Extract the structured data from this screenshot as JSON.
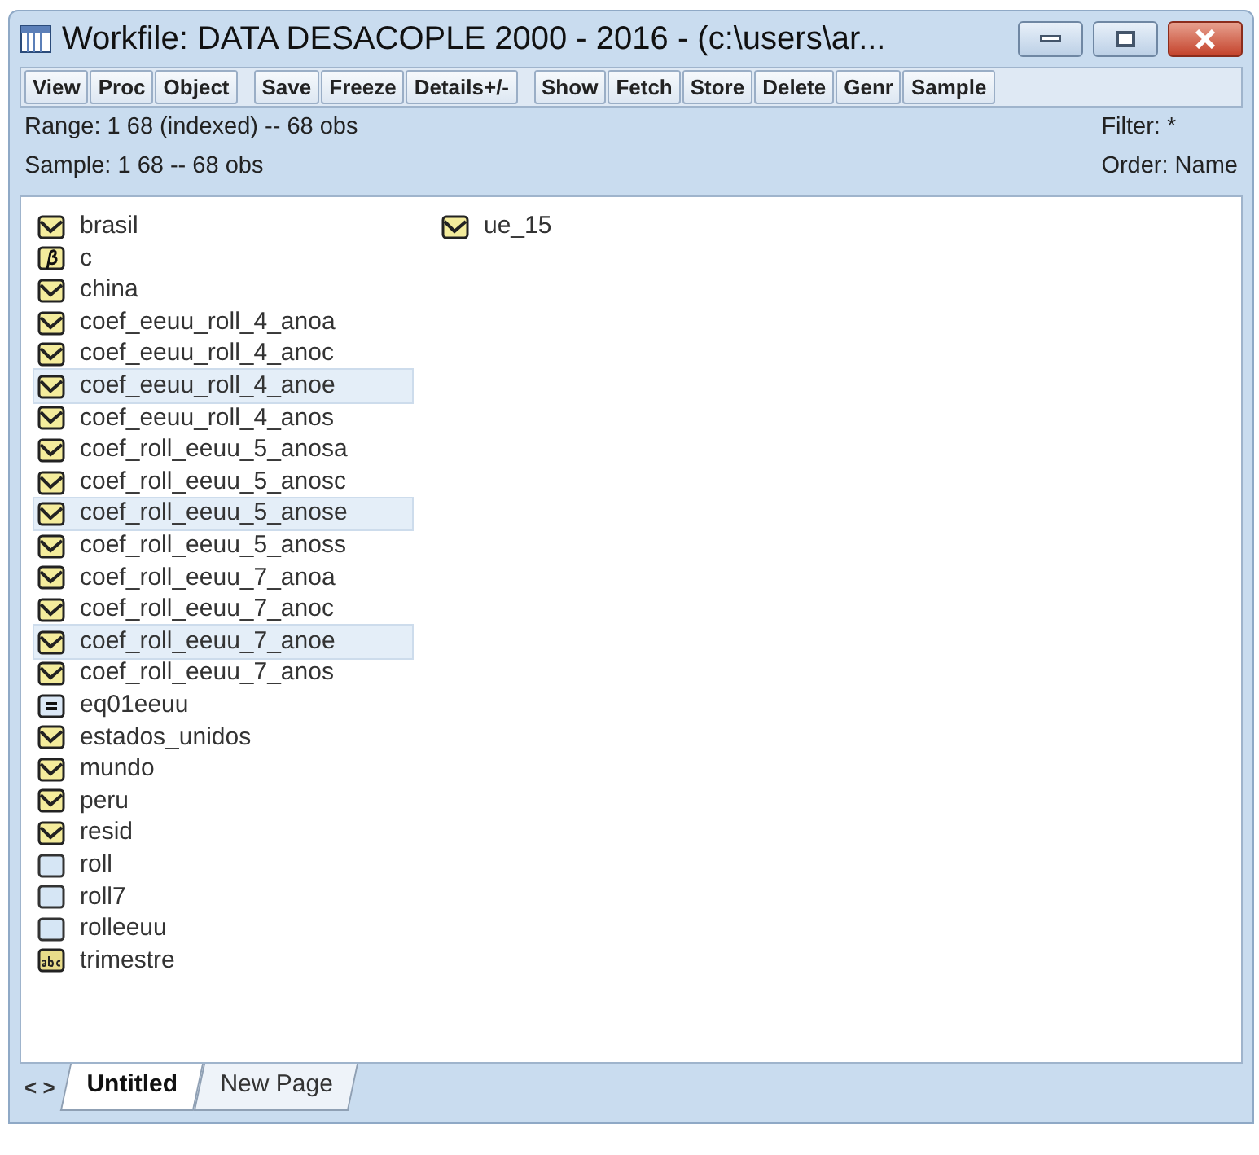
{
  "window": {
    "title": "Workfile: DATA DESACOPLE 2000 - 2016 - (c:\\users\\ar..."
  },
  "toolbar": {
    "groups": [
      [
        "View",
        "Proc",
        "Object"
      ],
      [
        "Save",
        "Freeze",
        "Details+/-"
      ],
      [
        "Show",
        "Fetch",
        "Store",
        "Delete",
        "Genr",
        "Sample"
      ]
    ]
  },
  "info": {
    "range": "Range:  1 68 (indexed)  --  68 obs",
    "sample": "Sample: 1 68  --  68 obs",
    "filter": "Filter: *",
    "order": "Order: Name"
  },
  "objects": {
    "columns": [
      [
        {
          "name": "brasil",
          "kind": "series",
          "selected": false
        },
        {
          "name": "c",
          "kind": "coef",
          "selected": false
        },
        {
          "name": "china",
          "kind": "series",
          "selected": false
        },
        {
          "name": "coef_eeuu_roll_4_anoa",
          "kind": "series",
          "selected": false
        },
        {
          "name": "coef_eeuu_roll_4_anoc",
          "kind": "series",
          "selected": false
        },
        {
          "name": "coef_eeuu_roll_4_anoe",
          "kind": "series",
          "selected": true
        },
        {
          "name": "coef_eeuu_roll_4_anos",
          "kind": "series",
          "selected": false
        },
        {
          "name": "coef_roll_eeuu_5_anosa",
          "kind": "series",
          "selected": false
        },
        {
          "name": "coef_roll_eeuu_5_anosc",
          "kind": "series",
          "selected": false
        },
        {
          "name": "coef_roll_eeuu_5_anose",
          "kind": "series",
          "selected": true
        },
        {
          "name": "coef_roll_eeuu_5_anoss",
          "kind": "series",
          "selected": false
        },
        {
          "name": "coef_roll_eeuu_7_anoa",
          "kind": "series",
          "selected": false
        },
        {
          "name": "coef_roll_eeuu_7_anoc",
          "kind": "series",
          "selected": false
        },
        {
          "name": "coef_roll_eeuu_7_anoe",
          "kind": "series",
          "selected": true
        },
        {
          "name": "coef_roll_eeuu_7_anos",
          "kind": "series",
          "selected": false
        },
        {
          "name": "eq01eeuu",
          "kind": "equation",
          "selected": false
        },
        {
          "name": "estados_unidos",
          "kind": "series",
          "selected": false
        },
        {
          "name": "mundo",
          "kind": "series",
          "selected": false
        },
        {
          "name": "peru",
          "kind": "series",
          "selected": false
        },
        {
          "name": "resid",
          "kind": "series",
          "selected": false
        },
        {
          "name": "roll",
          "kind": "empty",
          "selected": false
        },
        {
          "name": "roll7",
          "kind": "empty",
          "selected": false
        },
        {
          "name": "rolleeuu",
          "kind": "empty",
          "selected": false
        },
        {
          "name": "trimestre",
          "kind": "alpha",
          "selected": false
        }
      ],
      [
        {
          "name": "ue_15",
          "kind": "series",
          "selected": false
        }
      ]
    ]
  },
  "page_tabs": {
    "nav": "< >",
    "tabs": [
      {
        "label": "Untitled",
        "selected": true
      },
      {
        "label": "New Page",
        "selected": false
      }
    ]
  }
}
